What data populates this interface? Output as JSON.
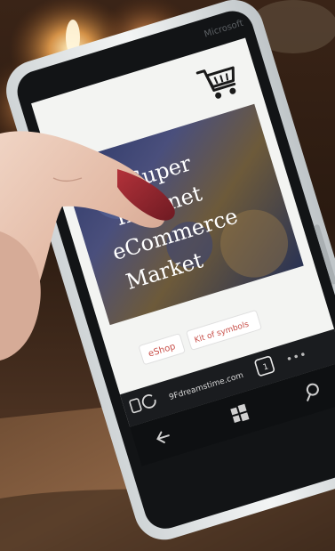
{
  "phone": {
    "brand": "Microsoft",
    "screen": {
      "banner": {
        "line1": "Super",
        "line2": "Internet",
        "line3": "eCommerce",
        "line4": "Market"
      },
      "links": {
        "eshop": "eShop",
        "kit": "Kit of symbols"
      },
      "address_bar": {
        "url_text": "9Fdreamstime.com"
      }
    }
  },
  "colors": {
    "screen": "#f3f4f2",
    "phone_body": "#e9ecec",
    "bezel": "#121416",
    "link_red": "#c8504a"
  }
}
